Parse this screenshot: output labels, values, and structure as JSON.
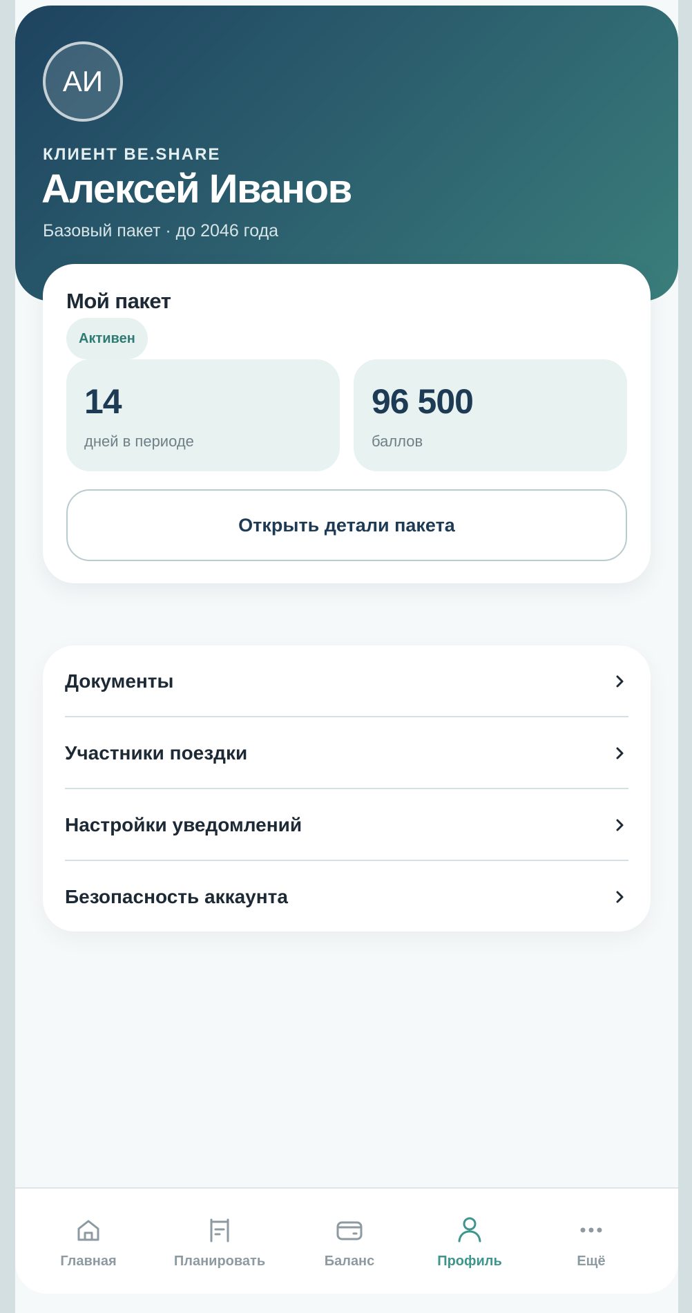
{
  "profile": {
    "initials": "АИ",
    "eyebrow": "КЛИЕНТ BE.SHARE",
    "name": "Алексей Иванов",
    "subtitle": "Базовый пакет · до 2046 года"
  },
  "package": {
    "title": "Мой пакет",
    "status": "Активен",
    "stats": [
      {
        "value": "14",
        "label": "дней в периоде"
      },
      {
        "value": "96 500",
        "label": "баллов"
      }
    ],
    "details_button": "Открыть детали пакета"
  },
  "menu": {
    "items": [
      {
        "label": "Документы",
        "icon": "chevron-right-icon"
      },
      {
        "label": "Участники поездки",
        "icon": "chevron-right-icon"
      },
      {
        "label": "Настройки уведомлений",
        "icon": "chevron-right-icon"
      },
      {
        "label": "Безопасность аккаунта",
        "icon": "chevron-right-icon"
      }
    ]
  },
  "nav": {
    "active": "Профиль",
    "items": [
      {
        "label": "Главная",
        "icon": "home-icon"
      },
      {
        "label": "Планировать",
        "icon": "plan-icon"
      },
      {
        "label": "Баланс",
        "icon": "wallet-icon"
      },
      {
        "label": "Профиль",
        "icon": "profile-icon"
      },
      {
        "label": "Ещё",
        "icon": "more-icon"
      }
    ]
  },
  "colors": {
    "header_start": "#1e4360",
    "header_end": "#3a7e7b",
    "accent": "#3e958d",
    "text_dark": "#1e3b56",
    "muted": "#8d9aa1",
    "stat_bg": "#e8f2f1"
  }
}
